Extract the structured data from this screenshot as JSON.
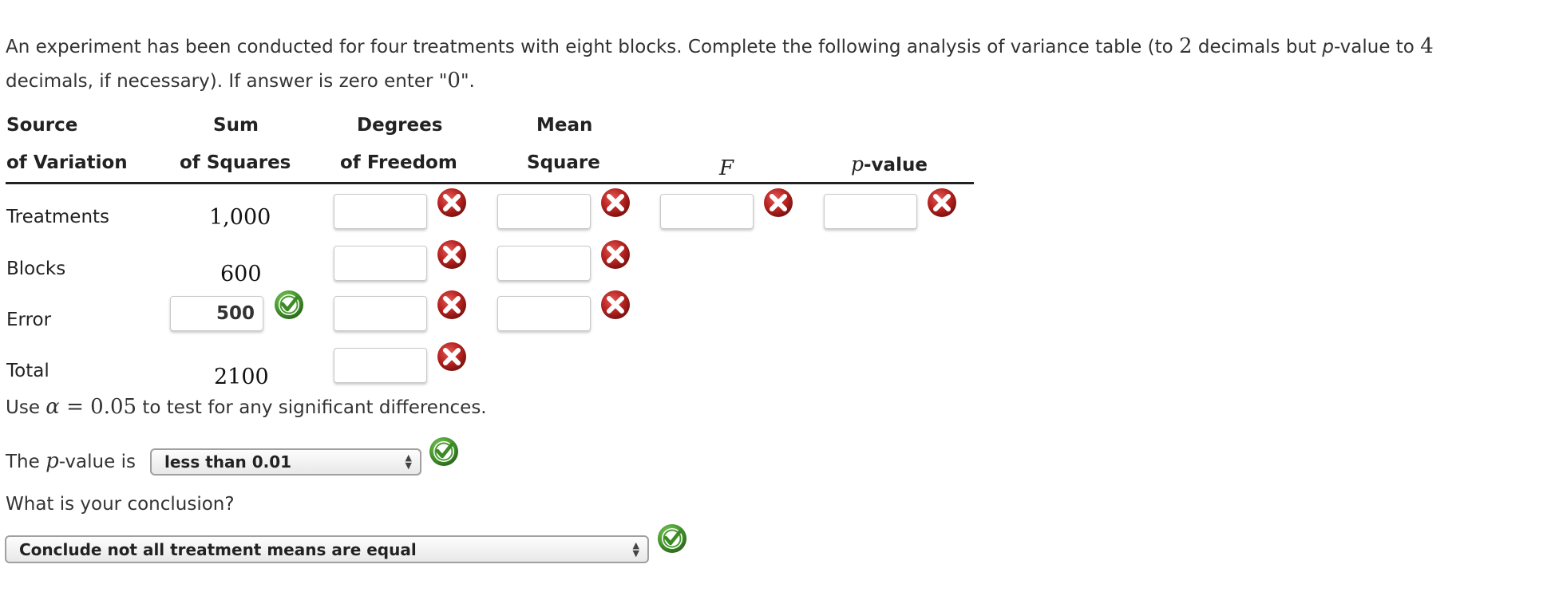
{
  "intro": {
    "line1_a": "An experiment has been conducted for four treatments with eight blocks. Complete the following analysis of variance table (to ",
    "decimals_general": "2",
    "line1_b": " decimals but ",
    "p_letter": "p",
    "line1_c": "-value to ",
    "decimals_pvalue": "4",
    "line2_a": "decimals, if necessary). If answer is zero enter \"",
    "zero_value": "0",
    "line2_b": "\"."
  },
  "table": {
    "headers": {
      "source_1": "Source",
      "source_2": "of Variation",
      "ss_1": "Sum",
      "ss_2": "of Squares",
      "df_1": "Degrees",
      "df_2": "of Freedom",
      "ms_1": "Mean",
      "ms_2": "Square",
      "f": "F",
      "p_letter": "p",
      "p_rest": "-value"
    },
    "rows": [
      {
        "source": "Treatments",
        "ss": "1,000",
        "df": "",
        "ms": "",
        "f": "",
        "p": "",
        "df_status": "incorrect",
        "ms_status": "incorrect",
        "f_status": "incorrect",
        "p_status": "incorrect"
      },
      {
        "source": "Blocks",
        "ss": "600",
        "df": "",
        "ms": "",
        "df_status": "incorrect",
        "ms_status": "incorrect"
      },
      {
        "source": "Error",
        "ss": "500",
        "ss_status": "correct",
        "df": "",
        "ms": "",
        "df_status": "incorrect",
        "ms_status": "incorrect"
      },
      {
        "source": "Total",
        "ss": "2100",
        "df": "",
        "df_status": "incorrect"
      }
    ]
  },
  "alpha_line": {
    "pre": "Use ",
    "alpha_symbol": "α",
    "equals": " = ",
    "alpha_value": "0.05",
    "post": " to test for any significant differences."
  },
  "pvalue_question": {
    "pre": "The ",
    "p_letter": "p",
    "post": "-value is",
    "selected": "less than 0.01",
    "status": "correct"
  },
  "conclusion_question": {
    "label": "What is your conclusion?",
    "selected": "Conclude not all treatment means are equal",
    "status": "correct"
  },
  "colors": {
    "incorrect": "#b3201f",
    "correct": "#3c9a2a",
    "rule": "#222222"
  }
}
